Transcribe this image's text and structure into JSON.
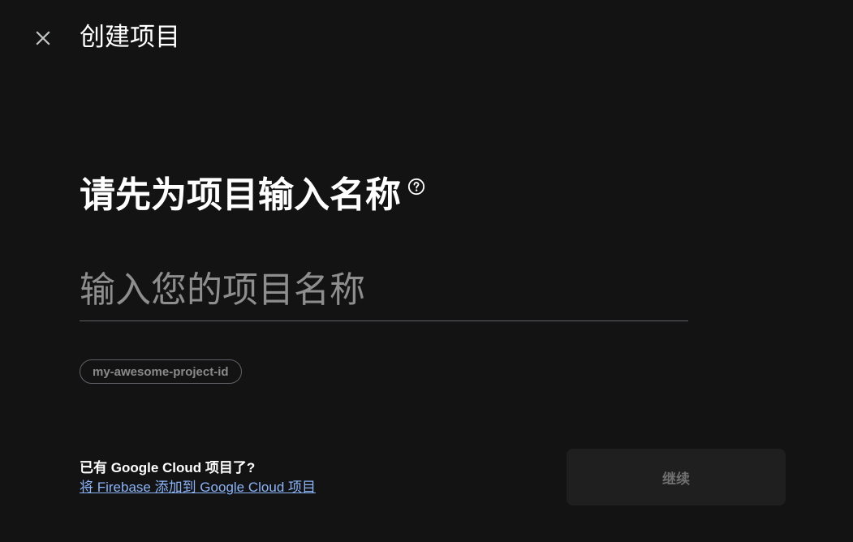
{
  "header": {
    "close_icon": "close-icon",
    "title": "创建项目"
  },
  "main": {
    "heading": "请先为项目输入名称",
    "help_icon": "help-circle-icon",
    "name_input": {
      "value": "",
      "placeholder": "输入您的项目名称"
    },
    "project_id": "my-awesome-project-id"
  },
  "footer": {
    "existing_question": "已有 Google Cloud 项目了?",
    "existing_link": "将 Firebase 添加到 Google Cloud 项目",
    "continue_label": "继续"
  },
  "colors": {
    "background": "#131314",
    "link": "#8ab4f8",
    "disabled_button_bg": "#1f1f1f",
    "disabled_button_text": "#6f6f6f"
  }
}
